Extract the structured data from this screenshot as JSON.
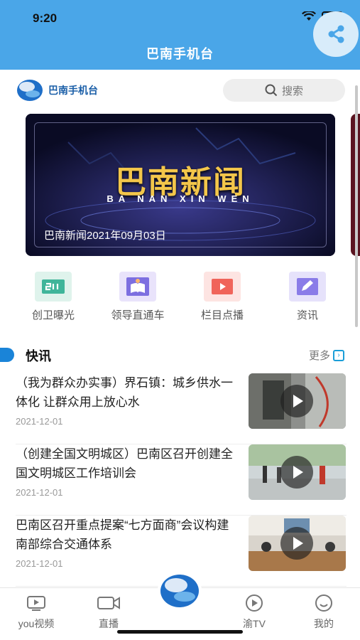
{
  "status": {
    "time": "9:20"
  },
  "header": {
    "title": "巴南手机台"
  },
  "logo": {
    "text": "巴南手机台"
  },
  "search": {
    "placeholder": "搜索"
  },
  "banner": {
    "title": "巴南新闻",
    "subtitle": "BA NAN XIN WEN",
    "caption": "巴南新闻2021年09月03日"
  },
  "quicknav": {
    "items": [
      {
        "label": "创卫曝光",
        "icon": "creation-icon",
        "color": "#3fb59a"
      },
      {
        "label": "领导直通车",
        "icon": "book-icon",
        "color": "#7d6fe0"
      },
      {
        "label": "栏目点播",
        "icon": "video-play-icon",
        "color": "#f0645a"
      },
      {
        "label": "资讯",
        "icon": "edit-icon",
        "color": "#8a7ce8"
      }
    ]
  },
  "section": {
    "title": "快讯",
    "more": "更多"
  },
  "news": [
    {
      "title": "（我为群众办实事）界石镇：城乡供水一体化 让群众用上放心水",
      "date": "2021-12-01"
    },
    {
      "title": "（创建全国文明城区）巴南区召开创建全国文明城区工作培训会",
      "date": "2021-12-01"
    },
    {
      "title": "巴南区召开重点提案“七方面商”会议构建南部综合交通体系",
      "date": "2021-12-01"
    }
  ],
  "tabs": [
    {
      "label": "you视频",
      "icon": "video-icon"
    },
    {
      "label": "直播",
      "icon": "camera-icon"
    },
    {
      "label": "",
      "icon": "home-logo-icon"
    },
    {
      "label": "渝TV",
      "icon": "tv-play-icon"
    },
    {
      "label": "我的",
      "icon": "smile-icon"
    }
  ],
  "colors": {
    "header": "#4aa6e8",
    "accent": "#1a84d8",
    "banner_gold": "#f3c64a"
  }
}
